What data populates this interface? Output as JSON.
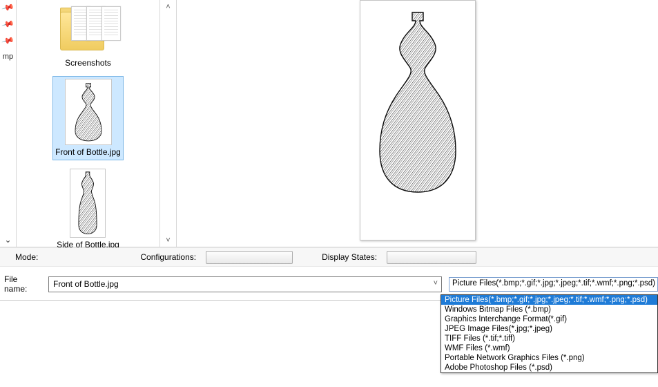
{
  "sidebar": {
    "label_mp": "mp"
  },
  "files": {
    "item0": {
      "label": "Screenshots"
    },
    "item1": {
      "label": "Front of Bottle.jpg",
      "selected": true
    },
    "item2": {
      "label": "Side of Bottle.jpg"
    }
  },
  "modebar": {
    "mode_label": "Mode:",
    "config_label": "Configurations:",
    "displaystates_label": "Display States:"
  },
  "filename": {
    "label": "File name:",
    "value": "Front of Bottle.jpg"
  },
  "filetype": {
    "current": "Picture Files(*.bmp;*.gif;*.jpg;*.jpeg;*.tif;*.wmf;*.png;*.psd)",
    "options": {
      "o0": "Picture Files(*.bmp;*.gif;*.jpg;*.jpeg;*.tif;*.wmf;*.png;*.psd)",
      "o1": "Windows Bitmap Files (*.bmp)",
      "o2": "Graphics Interchange Format(*.gif)",
      "o3": "JPEG Image Files(*.jpg;*.jpeg)",
      "o4": "TIFF Files (*.tif;*.tiff)",
      "o5": "WMF Files (*.wmf)",
      "o6": "Portable Network Graphics Files (*.png)",
      "o7": "Adobe Photoshop Files (*.psd)"
    }
  }
}
